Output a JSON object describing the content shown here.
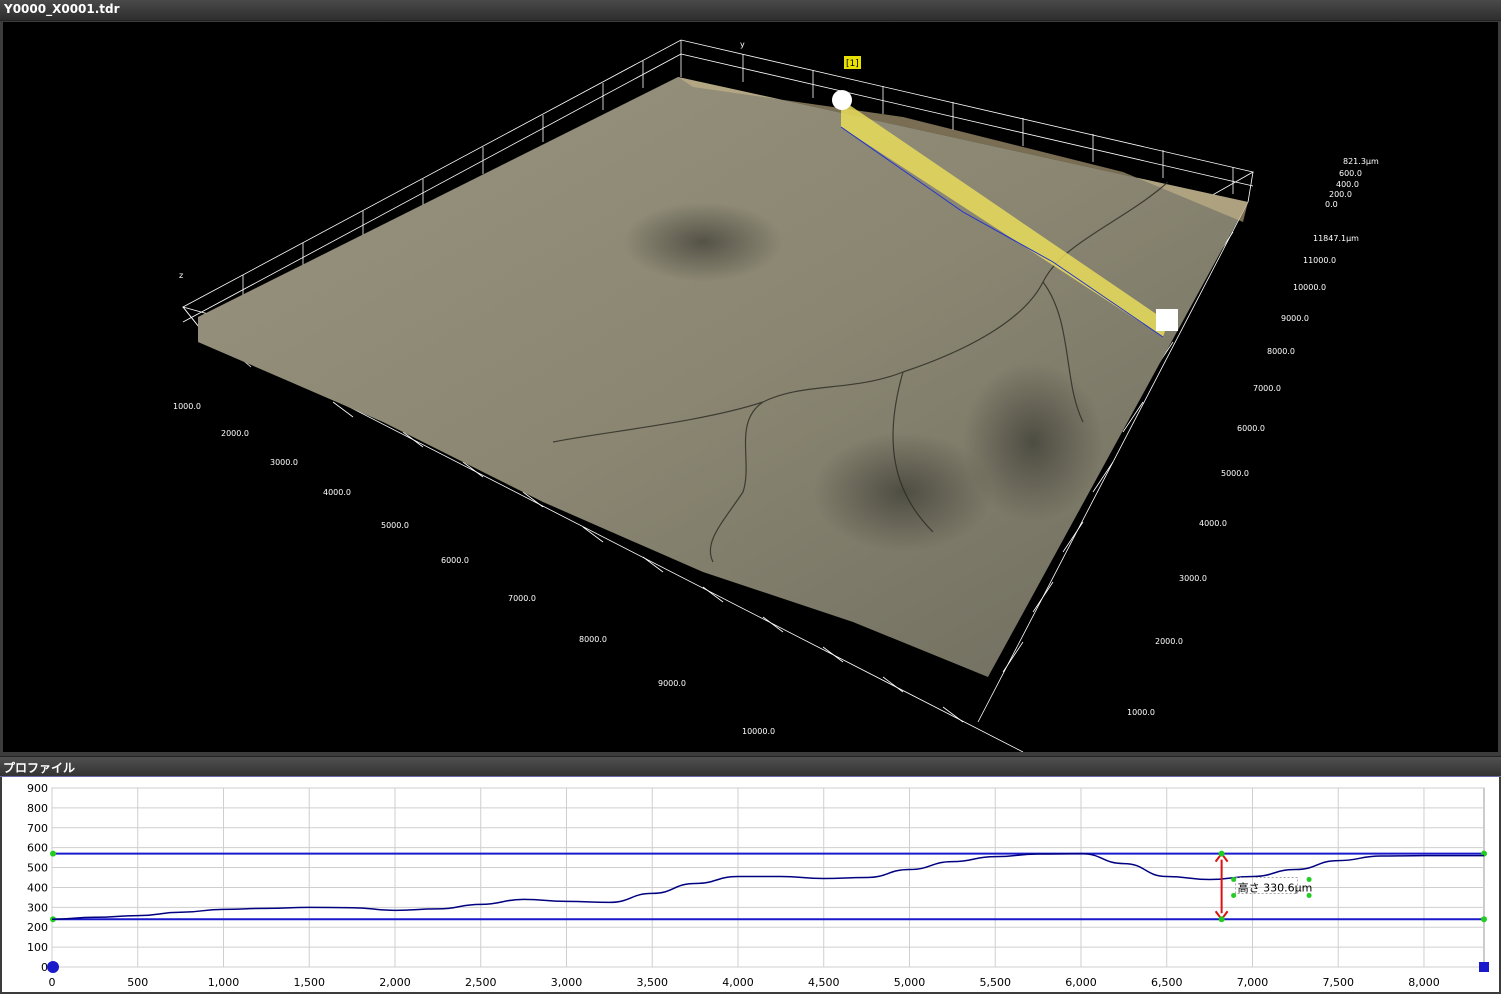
{
  "window": {
    "title": "Y0000_X0001.tdr"
  },
  "view3d": {
    "marker_label": "[1]",
    "axis_y_label": "y",
    "axis_z_label": "z",
    "z_ticks": [
      "821.3μm",
      "600.0",
      "400.0",
      "200.0",
      "0.0"
    ],
    "right_ticks": [
      "11847.1μm",
      "11000.0",
      "10000.0",
      "9000.0",
      "8000.0",
      "7000.0",
      "6000.0",
      "5000.0",
      "4000.0",
      "3000.0",
      "2000.0",
      "1000.0"
    ],
    "left_ticks": [
      "1000.0",
      "2000.0",
      "3000.0",
      "4000.0",
      "5000.0",
      "6000.0",
      "7000.0",
      "8000.0",
      "9000.0",
      "10000.0"
    ],
    "colors": {
      "surface": "#8a8672",
      "highlight": "#e8dc5a",
      "grid": "#ffffff"
    }
  },
  "profile": {
    "panel_title": "プロファイル",
    "measurement_label": "高さ 330.6μm",
    "colors": {
      "line": "#000080",
      "reference": "#1a1acc",
      "arrow": "#dd1111",
      "handle": "#22cc22"
    }
  },
  "chart_data": {
    "type": "line",
    "title": "",
    "xlabel": "",
    "ylabel": "",
    "xlim": [
      0,
      8350
    ],
    "ylim": [
      0,
      900
    ],
    "x_ticks": [
      "0",
      "500",
      "1,000",
      "1,500",
      "2,000",
      "2,500",
      "3,000",
      "3,500",
      "4,000",
      "4,500",
      "5,000",
      "5,500",
      "6,000",
      "6,500",
      "7,000",
      "7,500",
      "8,000"
    ],
    "y_ticks": [
      "900",
      "800",
      "700",
      "600",
      "500",
      "400",
      "300",
      "200",
      "100",
      "0"
    ],
    "grid": true,
    "series": [
      {
        "x": [
          0,
          250,
          500,
          750,
          1000,
          1250,
          1500,
          1750,
          2000,
          2250,
          2500,
          2750,
          3000,
          3250,
          3500,
          3750,
          4000,
          4250,
          4500,
          4750,
          5000,
          5250,
          5500,
          5750,
          6000,
          6250,
          6500,
          6750,
          7000,
          7250,
          7500,
          7750,
          8000,
          8350
        ],
        "values": [
          240,
          250,
          258,
          275,
          290,
          295,
          300,
          298,
          285,
          292,
          315,
          340,
          330,
          325,
          370,
          420,
          455,
          455,
          445,
          450,
          490,
          530,
          555,
          568,
          570,
          520,
          455,
          440,
          455,
          490,
          535,
          558,
          560,
          560
        ]
      }
    ],
    "reference_lines": [
      570,
      240
    ]
  }
}
